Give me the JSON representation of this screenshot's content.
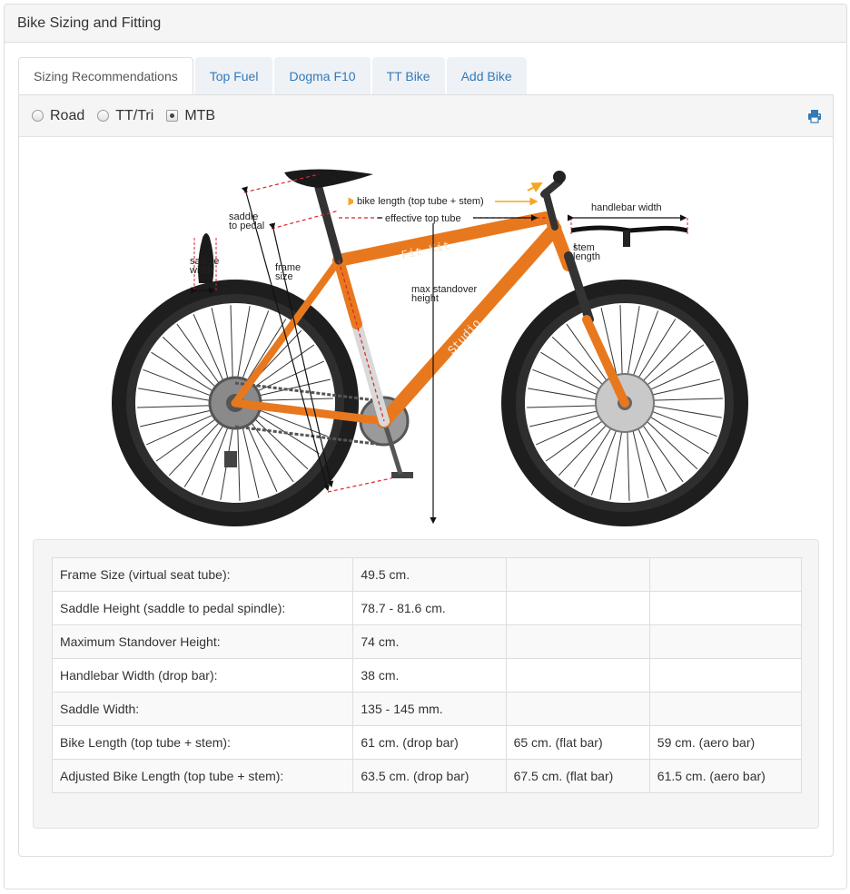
{
  "panel": {
    "title": "Bike Sizing and Fitting"
  },
  "tabs": [
    {
      "label": "Sizing Recommendations",
      "active": true
    },
    {
      "label": "Top Fuel",
      "active": false
    },
    {
      "label": "Dogma F10",
      "active": false
    },
    {
      "label": "TT Bike",
      "active": false
    },
    {
      "label": "Add Bike",
      "active": false
    }
  ],
  "bike_types": [
    {
      "label": "Road",
      "selected": false
    },
    {
      "label": "TT/Tri",
      "selected": false
    },
    {
      "label": "MTB",
      "selected": true
    }
  ],
  "print_icon": "print-icon",
  "diagram": {
    "labels": {
      "bike_length": "bike length (top tube + stem)",
      "effective_top_tube": "effective top tube",
      "handlebar_width": "handlebar width",
      "saddle_to_pedal_1": "saddle",
      "saddle_to_pedal_2": "to pedal",
      "saddle_width_1": "saddle",
      "saddle_width_2": "width",
      "frame_size_1": "frame",
      "frame_size_2": "size",
      "max_standover_1": "max standover",
      "max_standover_2": "height",
      "stem_length_1": "stem",
      "stem_length_2": "length",
      "frame_decal_1": "Fit Kit",
      "frame_decal_2": "Studio"
    },
    "colors": {
      "frame": "#e8781e",
      "tire": "#1e1e1e",
      "measure": "#d9252b",
      "arrow_accent": "#f5a623"
    }
  },
  "sizing_table": {
    "rows": [
      {
        "label": "Frame Size (virtual seat tube):",
        "values": [
          "49.5 cm.",
          "",
          ""
        ]
      },
      {
        "label": "Saddle Height (saddle to pedal spindle):",
        "values": [
          "78.7 - 81.6 cm.",
          "",
          ""
        ]
      },
      {
        "label": "Maximum Standover Height:",
        "values": [
          "74 cm.",
          "",
          ""
        ]
      },
      {
        "label": "Handlebar Width (drop bar):",
        "values": [
          "38 cm.",
          "",
          ""
        ]
      },
      {
        "label": "Saddle Width:",
        "values": [
          "135 - 145 mm.",
          "",
          ""
        ]
      },
      {
        "label": "Bike Length (top tube + stem):",
        "values": [
          "61 cm. (drop bar)",
          "65 cm. (flat bar)",
          "59 cm. (aero bar)"
        ]
      },
      {
        "label": "Adjusted Bike Length (top tube + stem):",
        "values": [
          "63.5 cm. (drop bar)",
          "67.5 cm. (flat bar)",
          "61.5 cm. (aero bar)"
        ]
      }
    ]
  }
}
